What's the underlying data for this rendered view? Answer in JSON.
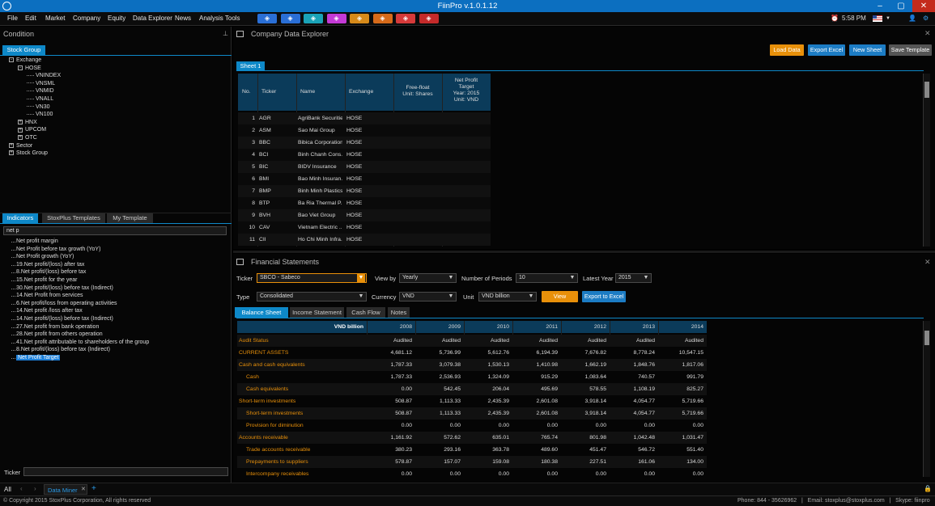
{
  "titlebar": {
    "title": "FiinPro v.1.0.1.12"
  },
  "menu": {
    "items": [
      "File",
      "Edit",
      "Market",
      "Company",
      "Equity",
      "Data Explorer",
      "News",
      "Analysis Tools"
    ],
    "time": "5:58 PM",
    "quick_colors": [
      "#2a6fd6",
      "#2a6fd6",
      "#1aa3b8",
      "#c43ad6",
      "#d68a1a",
      "#d66a1a",
      "#d63a3a",
      "#c42a2a"
    ]
  },
  "condition": {
    "title": "Condition",
    "tab": "Stock Group",
    "tree": [
      {
        "label": "Exchange",
        "level": 0,
        "exp": "-"
      },
      {
        "label": "HOSE",
        "level": 1,
        "exp": "-"
      },
      {
        "label": "VNINDEX",
        "level": 2
      },
      {
        "label": "VNSML",
        "level": 2
      },
      {
        "label": "VNMID",
        "level": 2
      },
      {
        "label": "VNALL",
        "level": 2
      },
      {
        "label": "VN30",
        "level": 2
      },
      {
        "label": "VN100",
        "level": 2
      },
      {
        "label": "HNX",
        "level": 1,
        "exp": "+"
      },
      {
        "label": "UPCOM",
        "level": 1,
        "exp": "+"
      },
      {
        "label": "OTC",
        "level": 1,
        "exp": "+"
      },
      {
        "label": "Sector",
        "level": 0,
        "exp": "+"
      },
      {
        "label": "Stock Group",
        "level": 0,
        "exp": "+"
      }
    ]
  },
  "indicators": {
    "tabs": [
      "Indicators",
      "StoxPlus Templates",
      "My Template"
    ],
    "search_value": "net p",
    "items": [
      "Net profit margin",
      "Net Profit before tax growth (YoY)",
      "Net Profit growth (YoY)",
      "19.Net profit/(loss) after tax",
      "8.Net profit/(loss) before tax",
      "15.Net profit for the year",
      "30.Net profit/(loss) before tax (Indirect)",
      "14.Net Profit from services",
      "6.Net profit/loss from operating activities",
      "14.Net profit /loss after tax",
      "14.Net profit/(loss) before tax (Indirect)",
      "27.Net profit from bank operation",
      "28.Net profit from others operation",
      "41.Net profit attributable to shareholders of the group",
      "8.Net profit/(loss) before tax (Indirect)",
      "Net Profit Target"
    ],
    "ticker_label": "Ticker"
  },
  "explorer": {
    "title": "Company Data Explorer",
    "buttons": [
      "Load Data",
      "Export Excel",
      "New Sheet",
      "Save Template"
    ],
    "sheet_tab": "Sheet 1",
    "headers": [
      "No.",
      "Ticker",
      "Name",
      "Exchange",
      "Free-float\nUnit: Shares",
      "Net Profit\nTarget\nYear: 2015\nUnit: VND"
    ],
    "rows": [
      [
        "1",
        "AGR",
        "AgriBank Securities",
        "HOSE"
      ],
      [
        "2",
        "ASM",
        "Sao Mai Group",
        "HOSE"
      ],
      [
        "3",
        "BBC",
        "Bibica Corporation",
        "HOSE"
      ],
      [
        "4",
        "BCI",
        "Binh Chanh Cons...",
        "HOSE"
      ],
      [
        "5",
        "BIC",
        "BIDV Insurance",
        "HOSE"
      ],
      [
        "6",
        "BMI",
        "Bao Minh Insuran...",
        "HOSE"
      ],
      [
        "7",
        "BMP",
        "Binh Minh Plastics",
        "HOSE"
      ],
      [
        "8",
        "BTP",
        "Ba Ria Thermal P...",
        "HOSE"
      ],
      [
        "9",
        "BVH",
        "Bao Viet Group",
        "HOSE"
      ],
      [
        "10",
        "CAV",
        "Vietnam Electric ...",
        "HOSE"
      ],
      [
        "11",
        "CII",
        "Ho Chi Minh Infra...",
        "HOSE"
      ]
    ]
  },
  "fs": {
    "title": "Financial Statements",
    "ticker_label": "Ticker",
    "ticker_value": "SBCO - Sabeco",
    "viewby_label": "View by",
    "viewby_value": "Yearly",
    "periods_label": "Number of Periods",
    "periods_value": "10",
    "latest_label": "Latest Year",
    "latest_value": "2015",
    "type_label": "Type",
    "type_value": "Consolidated",
    "currency_label": "Currency",
    "currency_value": "VND",
    "unit_label": "Unit",
    "unit_value": "VND billion",
    "view_btn": "View",
    "export_btn": "Export to Excel",
    "tabs": [
      "Balance Sheet",
      "Income Statement",
      "Cash Flow",
      "Notes"
    ],
    "unit_header": "VND billion",
    "years": [
      "2008",
      "2009",
      "2010",
      "2011",
      "2012",
      "2013",
      "2014"
    ],
    "rows": [
      {
        "label": "Audit Status",
        "indent": 0,
        "vals": [
          "Audited",
          "Audited",
          "Audited",
          "Audited",
          "Audited",
          "Audited",
          "Audited"
        ]
      },
      {
        "label": "CURRENT ASSETS",
        "indent": 0,
        "vals": [
          "4,681.12",
          "5,736.99",
          "5,612.76",
          "6,194.39",
          "7,676.82",
          "8,778.24",
          "10,547.15"
        ]
      },
      {
        "label": "Cash and cash equivalents",
        "indent": 0,
        "vals": [
          "1,787.33",
          "3,079.38",
          "1,530.13",
          "1,410.98",
          "1,662.19",
          "1,848.76",
          "1,817.06"
        ]
      },
      {
        "label": "Cash",
        "indent": 1,
        "vals": [
          "1,787.33",
          "2,536.93",
          "1,324.09",
          "915.29",
          "1,083.64",
          "740.57",
          "991.79"
        ]
      },
      {
        "label": "Cash equivalents",
        "indent": 1,
        "vals": [
          "0.00",
          "542.45",
          "206.04",
          "495.69",
          "578.55",
          "1,108.19",
          "825.27"
        ]
      },
      {
        "label": "Short-term investments",
        "indent": 0,
        "vals": [
          "508.87",
          "1,113.33",
          "2,435.39",
          "2,601.08",
          "3,918.14",
          "4,054.77",
          "5,719.66"
        ]
      },
      {
        "label": "Short-term investments",
        "indent": 1,
        "vals": [
          "508.87",
          "1,113.33",
          "2,435.39",
          "2,601.08",
          "3,918.14",
          "4,054.77",
          "5,719.66"
        ]
      },
      {
        "label": "Provision for diminution",
        "indent": 1,
        "vals": [
          "0.00",
          "0.00",
          "0.00",
          "0.00",
          "0.00",
          "0.00",
          "0.00"
        ]
      },
      {
        "label": "Accounts receivable",
        "indent": 0,
        "vals": [
          "1,161.92",
          "572.62",
          "635.01",
          "765.74",
          "801.98",
          "1,042.48",
          "1,031.47"
        ]
      },
      {
        "label": "Trade accounts receivable",
        "indent": 1,
        "vals": [
          "380.23",
          "293.16",
          "363.78",
          "489.60",
          "451.47",
          "546.72",
          "551.40"
        ]
      },
      {
        "label": "Prepayments to suppliers",
        "indent": 1,
        "vals": [
          "578.87",
          "157.07",
          "159.08",
          "180.38",
          "227.51",
          "161.06",
          "134.00"
        ]
      },
      {
        "label": "Intercompany receivables",
        "indent": 1,
        "vals": [
          "0.00",
          "0.00",
          "0.00",
          "0.00",
          "0.00",
          "0.00",
          "0.00"
        ]
      }
    ]
  },
  "footer": {
    "all_label": "All",
    "tab_label": "Data Miner",
    "copyright": "© Copyright 2015 StoxPlus Corporation, All rights reserved",
    "contact": "Phone: 844 - 35626962   |   Email: stoxplus@stoxplus.com   |   Skype: fiinpro"
  }
}
